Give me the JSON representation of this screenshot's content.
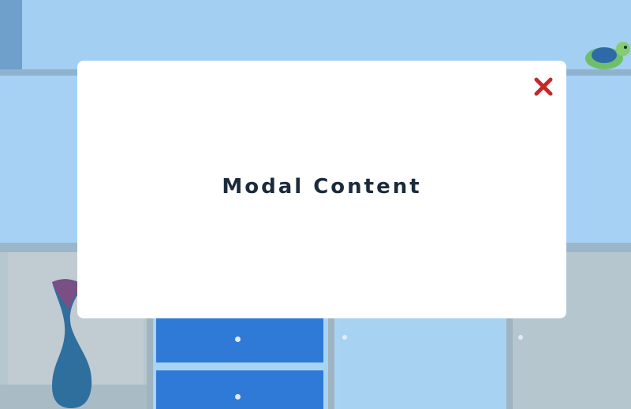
{
  "modal": {
    "content_text": "Modal Content",
    "close_icon": "close-x-icon",
    "close_color": "#c62828"
  },
  "background": {
    "description_icon": "room-furniture-photo"
  }
}
